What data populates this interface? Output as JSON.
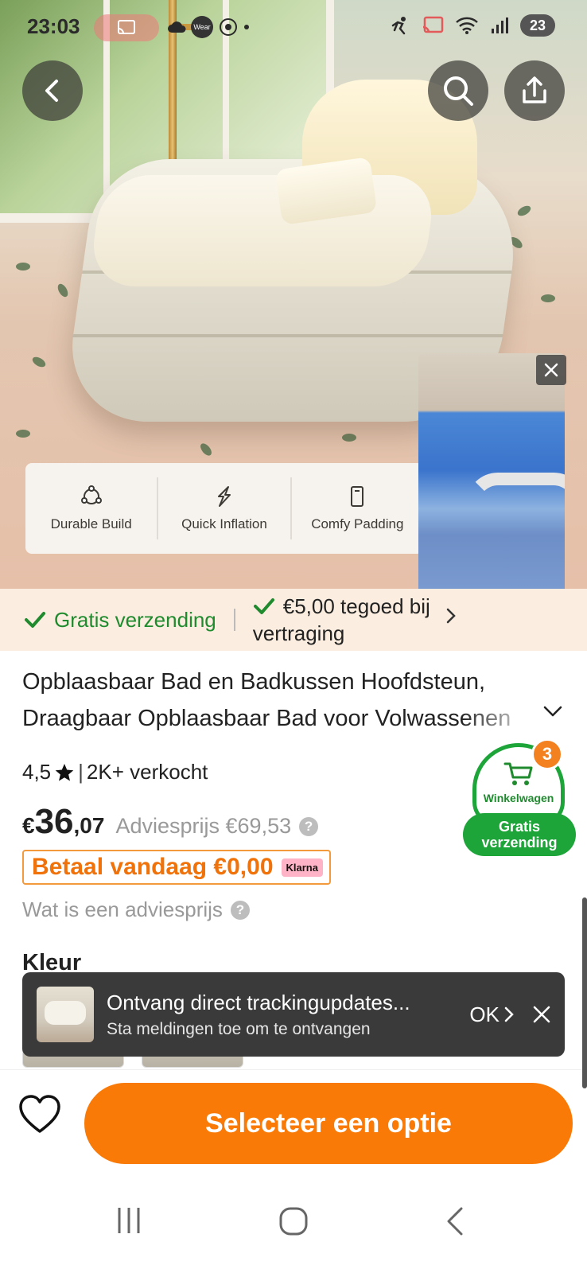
{
  "status_bar": {
    "time": "23:03",
    "wear_label": "Wear",
    "battery": "23"
  },
  "hero": {
    "features": [
      {
        "icon": "durable-icon",
        "label": "Durable Build"
      },
      {
        "icon": "lightning-icon",
        "label": "Quick Inflation"
      },
      {
        "icon": "padding-icon",
        "label": "Comfy Padding"
      }
    ]
  },
  "shipping": {
    "free_shipping": "Gratis verzending",
    "credit_line1": "€5,00 tegoed bij",
    "credit_line2": "vertraging"
  },
  "product": {
    "title_line1": "Opblaasbaar Bad en Badkussen Hoofdsteun,",
    "title_line2": "Draagbaar Opblaasbaar Bad voor Volwassenen",
    "rating": "4,5",
    "sold": "2K+ verkocht",
    "price_currency": "€",
    "price_int": "36",
    "price_dec": ",07",
    "msrp": "Adviesprijs €69,53",
    "pay_today": "Betaal vandaag €0,00",
    "klarna": "Klarna",
    "what_msrp": "Wat is een adviesprijs",
    "color_label": "Kleur"
  },
  "cart": {
    "count": "3",
    "label": "Winkelwagen",
    "free_line1": "Gratis",
    "free_line2": "verzending"
  },
  "toast": {
    "title": "Ontvang direct trackingupdates...",
    "subtitle": "Sta meldingen toe om te ontvangen",
    "ok": "OK"
  },
  "bottom": {
    "cta": "Selecteer een optie"
  },
  "colors": {
    "accent_orange": "#f97a06",
    "green": "#1ea53a",
    "banner_bg": "#fbeee0"
  }
}
